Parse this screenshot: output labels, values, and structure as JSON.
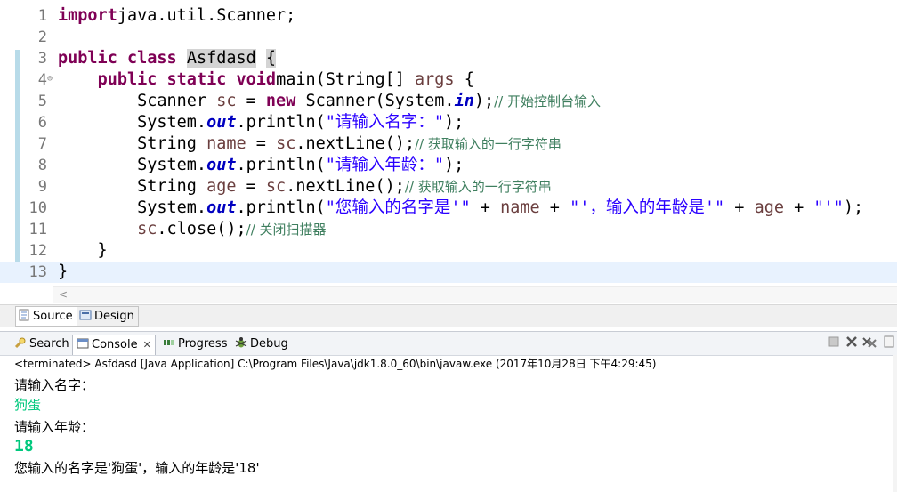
{
  "editor": {
    "lines": [
      {
        "n": "1",
        "tokens": [
          [
            "kw",
            "import"
          ],
          [
            "",
            "java.util.Scanner;"
          ]
        ]
      },
      {
        "n": "2",
        "tokens": []
      },
      {
        "n": "3",
        "tokens": [
          [
            "kw",
            "public"
          ],
          [
            "",
            ""
          ],
          [
            "kw",
            "class"
          ],
          [
            "",
            ""
          ],
          [
            "hl",
            "Asfdasd"
          ],
          [
            "",
            ""
          ],
          [
            "hlb",
            "{"
          ]
        ]
      },
      {
        "n": "4",
        "fold": "⊖",
        "tokens": [
          [
            "",
            "    "
          ],
          [
            "kw",
            "public"
          ],
          [
            "",
            ""
          ],
          [
            "kw",
            "static"
          ],
          [
            "",
            ""
          ],
          [
            "kw",
            "void"
          ],
          [
            "",
            "main(String[] "
          ],
          [
            "var",
            "args"
          ],
          [
            "",
            " {"
          ]
        ]
      },
      {
        "n": "5",
        "tokens": [
          [
            "",
            "        Scanner "
          ],
          [
            "var",
            "sc"
          ],
          [
            "",
            " = "
          ],
          [
            "kw",
            "new"
          ],
          [
            "",
            " Scanner(System."
          ],
          [
            "st",
            "in"
          ],
          [
            "",
            ");"
          ],
          [
            "cm",
            "// 开始控制台输入"
          ]
        ]
      },
      {
        "n": "6",
        "tokens": [
          [
            "",
            "        System."
          ],
          [
            "st",
            "out"
          ],
          [
            "",
            ".println("
          ],
          [
            "str",
            "\"请输入名字：\""
          ],
          [
            "",
            ");"
          ]
        ]
      },
      {
        "n": "7",
        "tokens": [
          [
            "",
            "        String "
          ],
          [
            "var",
            "name"
          ],
          [
            "",
            " = "
          ],
          [
            "var",
            "sc"
          ],
          [
            "",
            ".nextLine();"
          ],
          [
            "cm",
            "// 获取输入的一行字符串"
          ]
        ]
      },
      {
        "n": "8",
        "tokens": [
          [
            "",
            "        System."
          ],
          [
            "st",
            "out"
          ],
          [
            "",
            ".println("
          ],
          [
            "str",
            "\"请输入年龄：\""
          ],
          [
            "",
            ");"
          ]
        ]
      },
      {
        "n": "9",
        "tokens": [
          [
            "",
            "        String "
          ],
          [
            "var",
            "age"
          ],
          [
            "",
            " = "
          ],
          [
            "var",
            "sc"
          ],
          [
            "",
            ".nextLine();"
          ],
          [
            "cm",
            "// 获取输入的一行字符串"
          ]
        ]
      },
      {
        "n": "10",
        "tokens": [
          [
            "",
            "        System."
          ],
          [
            "st",
            "out"
          ],
          [
            "",
            ".println("
          ],
          [
            "str",
            "\"您输入的名字是'\""
          ],
          [
            "",
            " + "
          ],
          [
            "var",
            "name"
          ],
          [
            "",
            " + "
          ],
          [
            "str",
            "\"'，输入的年龄是'\""
          ],
          [
            "",
            " + "
          ],
          [
            "var",
            "age"
          ],
          [
            "",
            " + "
          ],
          [
            "str",
            "\"'\""
          ],
          [
            "",
            ");"
          ]
        ]
      },
      {
        "n": "11",
        "tokens": [
          [
            "",
            "        "
          ],
          [
            "var",
            "sc"
          ],
          [
            "",
            ".close();"
          ],
          [
            "cm",
            "// 关闭扫描器"
          ]
        ]
      },
      {
        "n": "12",
        "tokens": [
          [
            "",
            "    }"
          ]
        ]
      },
      {
        "n": "13",
        "tokens": [
          [
            "",
            "}"
          ]
        ]
      }
    ]
  },
  "scroll_arrow": "<",
  "editor_tabs": {
    "source": "Source",
    "design": "Design"
  },
  "view_tabs": {
    "search": "Search",
    "console": "Console",
    "console_close": "✕",
    "progress": "Progress",
    "debug": "Debug"
  },
  "status": "<terminated> Asfdasd [Java Application] C:\\Program Files\\Java\\jdk1.8.0_60\\bin\\javaw.exe (2017年10月28日 下午4:29:45)",
  "output": [
    {
      "text": "请输入名字：",
      "type": "out"
    },
    {
      "text": "狗蛋",
      "type": "in"
    },
    {
      "text": "请输入年龄：",
      "type": "out"
    },
    {
      "text": "18",
      "type": "in-num"
    },
    {
      "text": "您输入的名字是'狗蛋'，输入的年龄是'18'",
      "type": "out"
    }
  ],
  "icons": {
    "stop": "stop-icon",
    "remove": "remove-launch-icon",
    "remove_all": "remove-all-icon",
    "more": "view-menu-icon"
  }
}
